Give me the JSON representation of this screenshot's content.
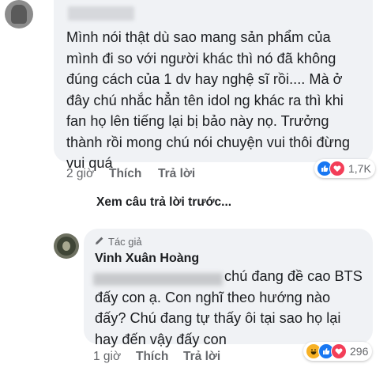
{
  "comment": {
    "text": "Mình nói thật dù sao mang sản phẩm của mình đi so với người khác thì nó đã không đúng cách của 1 dv hay nghệ sĩ rồi.... Mà ở đây chú nhắc hẳn tên idol ng khác ra thì khi fan họ lên tiếng lại bị bảo này nọ. Trưởng thành rồi mong chú nói chuyện vui thôi đừng vui quá",
    "time": "2 giờ",
    "like_label": "Thích",
    "reply_label": "Trả lời",
    "reaction_count": "1,7K",
    "reaction_icons": [
      "like-icon",
      "love-icon"
    ]
  },
  "more_replies_label": "Xem câu trả lời trước...",
  "reply": {
    "author_badge": "Tác giả",
    "name": "Vinh Xuân Hoàng",
    "text": "chú đang đề cao BTS đấy con ạ. Con nghĩ theo hướng nào đấy? Chú đang tự thấy ôi tại sao họ lại hay đến vậy đấy con",
    "time": "1 giờ",
    "like_label": "Thích",
    "reply_label": "Trả lời",
    "reaction_count": "296",
    "reaction_icons": [
      "haha-icon",
      "like-icon",
      "love-icon"
    ]
  },
  "colors": {
    "bubble": "#f0f2f5",
    "secondary_text": "#65676b",
    "like_blue": "#1877f2",
    "love_red": "#f33e58",
    "haha_yellow": "#f7b125"
  }
}
